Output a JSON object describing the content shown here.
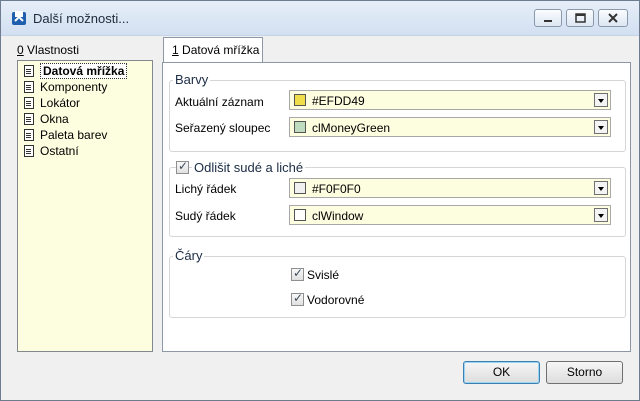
{
  "window": {
    "title": "Další možnosti..."
  },
  "left": {
    "label_prefix": "0",
    "label": " Vlastnosti",
    "items": [
      {
        "label": "Datová mřížka"
      },
      {
        "label": "Komponenty"
      },
      {
        "label": "Lokátor"
      },
      {
        "label": "Okna"
      },
      {
        "label": "Paleta barev"
      },
      {
        "label": "Ostatní"
      }
    ]
  },
  "tab": {
    "prefix": "1",
    "label": " Datová mřížka"
  },
  "barvy": {
    "title": "Barvy",
    "current_label": "Aktuální záznam",
    "current_value": "#EFDD49",
    "current_color": "#EFDD49",
    "sorted_label": "Seřazený sloupec",
    "sorted_value": "clMoneyGreen",
    "sorted_color": "#C0DCC0"
  },
  "odlisit": {
    "title": "Odlišit sudé a liché",
    "odd_label": "Lichý řádek",
    "odd_value": "#F0F0F0",
    "odd_color": "#F0F0F0",
    "even_label": "Sudý řádek",
    "even_value": "clWindow",
    "even_color": "#FFFFFF"
  },
  "cary": {
    "title": "Čáry",
    "vertical_label": "Svislé",
    "horizontal_label": "Vodorovné"
  },
  "buttons": {
    "ok": "OK",
    "cancel": "Storno"
  }
}
